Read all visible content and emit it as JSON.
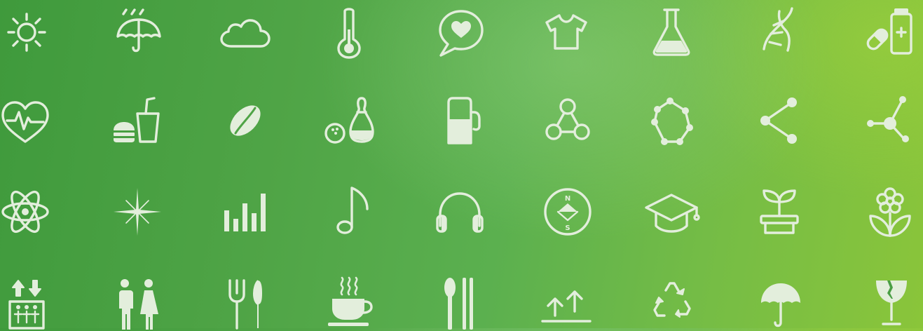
{
  "colors": {
    "icon": "#e3eedc",
    "background_left": "#3f9a3c",
    "background_right": "#8ac53a"
  },
  "icons": [
    [
      "sun-icon",
      "umbrella-rain-icon",
      "cloud-icon",
      "thermometer-icon",
      "speech-bubble-heart-icon",
      "t-shirt-icon",
      "lab-flask-icon",
      "dna-icon",
      "pill-bottle-icon"
    ],
    [
      "heart-rate-icon",
      "fast-food-icon",
      "coffee-bean-icon",
      "bowling-icon",
      "fuel-pump-icon",
      "molecule-icon",
      "polygon-nodes-icon",
      "share-icon",
      "network-node-icon"
    ],
    [
      "atom-icon",
      "sparkle-icon",
      "bar-chart-icon",
      "music-note-icon",
      "headphones-icon",
      "compass-icon",
      "graduation-cap-icon",
      "plant-pot-icon",
      "flower-icon"
    ],
    [
      "elevator-icon",
      "restroom-icon",
      "fork-knife-icon",
      "hot-cup-icon",
      "spoon-chopsticks-icon",
      "this-way-up-icon",
      "recycle-icon",
      "umbrella-icon",
      "fragile-glass-icon"
    ]
  ],
  "compass": {
    "north": "N",
    "south": "S"
  }
}
